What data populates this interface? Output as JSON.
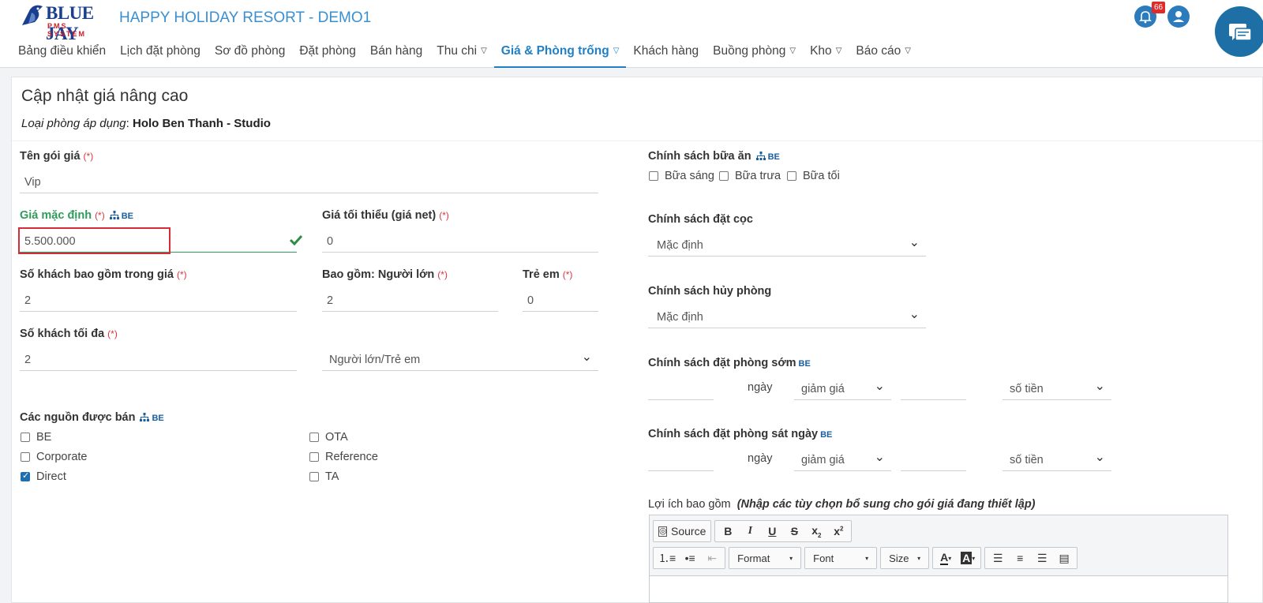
{
  "header": {
    "logo_text": "BLUE JAY",
    "logo_sub": "PMS SYSTEM",
    "title": "HAPPY HOLIDAY RESORT - DEMO1",
    "notification_count": "66",
    "nav": [
      {
        "label": "Bảng điều khiển"
      },
      {
        "label": "Lịch đặt phòng"
      },
      {
        "label": "Sơ đồ phòng"
      },
      {
        "label": "Đặt phòng"
      },
      {
        "label": "Bán hàng"
      },
      {
        "label": "Thu chi"
      },
      {
        "label": "Giá & Phòng trống"
      },
      {
        "label": "Khách hàng"
      },
      {
        "label": "Buồng phòng"
      },
      {
        "label": "Kho"
      },
      {
        "label": "Báo cáo"
      }
    ]
  },
  "form": {
    "title": "Cập nhật giá nâng cao",
    "room_type_label": "Loại phòng áp dụng",
    "room_type_value": "Holo Ben Thanh - Studio",
    "required_mark": "(*)",
    "be_tag": "BE",
    "package_name_label": "Tên gói giá",
    "package_name_value": "Vip",
    "default_price_label": "Giá mặc định",
    "default_price_value": "5.500.000",
    "min_price_label": "Giá tối thiểu (giá net)",
    "min_price_value": "0",
    "guests_included_label": "Số khách bao gồm trong giá",
    "guests_included_value": "2",
    "adults_label": "Bao gồm: Người lớn",
    "adults_value": "2",
    "children_label": "Trẻ em",
    "children_value": "0",
    "max_guests_label": "Số khách tối đa",
    "max_guests_value": "2",
    "guest_type_value": "Người lớn/Trẻ em",
    "sources_label": "Các nguồn được bán",
    "sources": [
      {
        "label": "BE",
        "checked": false
      },
      {
        "label": "Corporate",
        "checked": false
      },
      {
        "label": "Direct",
        "checked": true
      },
      {
        "label": "OTA",
        "checked": false
      },
      {
        "label": "Reference",
        "checked": false
      },
      {
        "label": "TA",
        "checked": false
      }
    ],
    "meal_policy_label": "Chính sách bữa ăn",
    "meals": [
      {
        "label": "Bữa sáng",
        "checked": false
      },
      {
        "label": "Bữa trưa",
        "checked": false
      },
      {
        "label": "Bữa tối",
        "checked": false
      }
    ],
    "deposit_policy_label": "Chính sách đặt cọc",
    "deposit_policy_value": "Mặc định",
    "cancel_policy_label": "Chính sách hủy phòng",
    "cancel_policy_value": "Mặc định",
    "early_booking_label": "Chính sách đặt phòng sớm",
    "late_booking_label": "Chính sách đặt phòng sát ngày",
    "day_label": "ngày",
    "discount_value": "giảm giá",
    "amount_type_value": "số tiền",
    "benefits_label": "Lợi ích bao gồm",
    "benefits_hint": "(Nhập các tùy chọn bổ sung cho gói giá đang thiết lập)"
  },
  "editor": {
    "source_label": "Source",
    "format_label": "Format",
    "font_label": "Font",
    "size_label": "Size"
  }
}
